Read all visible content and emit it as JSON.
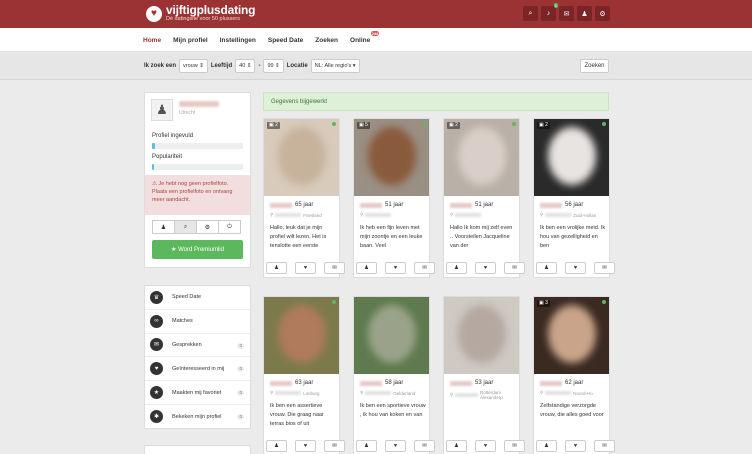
{
  "brand": {
    "name": "vijftigplusdating",
    "tagline": "Dé datingsite voor 50 plussers",
    "logo_icon": "heart-icon"
  },
  "top_icons": [
    {
      "name": "search-icon",
      "glyph": "⌕",
      "badge": ""
    },
    {
      "name": "bell-icon",
      "glyph": "♪",
      "badge": "1"
    },
    {
      "name": "envelope-icon",
      "glyph": "✉",
      "badge": ""
    },
    {
      "name": "user-icon",
      "glyph": "♟",
      "badge": ""
    },
    {
      "name": "gear-icon",
      "glyph": "⚙",
      "badge": ""
    }
  ],
  "nav": {
    "items": [
      "Home",
      "Mijn profiel",
      "Instellingen",
      "Speed Date",
      "Zoeken",
      "Online"
    ],
    "online_badge": "244"
  },
  "search": {
    "label_looking": "Ik zoek een",
    "gender": "vrouw",
    "label_age": "Leeftijd",
    "age_min": "40",
    "age_sep": "-",
    "age_max": "99",
    "label_location": "Locatie",
    "location": "NL: Alle regio's",
    "button": "Zoeken"
  },
  "profile": {
    "city": "Utrecht",
    "filled_label": "Profiel ingevuld",
    "filled_value": 0.03,
    "popularity_label": "Populariteit",
    "popularity_value": 0.02,
    "alert": "Je hebt nog geen profielfoto. Plaats een profielfoto en ontvang meer aandacht.",
    "premium_button": "Word Premiumlid"
  },
  "menu": [
    {
      "label": "Speed Date",
      "icon": "trophy-icon",
      "glyph": "♛",
      "count": ""
    },
    {
      "label": "Matches",
      "icon": "rings-icon",
      "glyph": "∞",
      "count": ""
    },
    {
      "label": "Gesprekken",
      "icon": "envelope-icon",
      "glyph": "✉",
      "count": "0"
    },
    {
      "label": "Geïnteresseerd in mij",
      "icon": "heart-icon",
      "glyph": "♥",
      "count": "0"
    },
    {
      "label": "Maakten mij favoriet",
      "icon": "star-icon",
      "glyph": "★",
      "count": "0"
    },
    {
      "label": "Bekeken mijn profiel",
      "icon": "users-icon",
      "glyph": "✱",
      "count": "0"
    }
  ],
  "success_message": "Gegevens bijgewerkt",
  "cards": [
    {
      "age": "65 jaar",
      "location": "Friesland",
      "photos": "2",
      "online": true,
      "desc": "Hallo, leuk dat je mijn profiel wilt lezen. Het is tenslotte een eerste",
      "color": "#d8cbbb",
      "blob": "#c7b29c"
    },
    {
      "age": "51 jaar",
      "location": "",
      "photos": "5",
      "online": true,
      "desc": "Ik heb een fijn leven met mijn zoontje en een leuke baan. Veel",
      "color": "#9a8f83",
      "blob": "#8a5a3c"
    },
    {
      "age": "51 jaar",
      "location": "",
      "photos": "2",
      "online": true,
      "desc": "Hallo Ik kom mij zelf even .. Voorstellen Jacqueline van der",
      "color": "#b9b1a8",
      "blob": "#d9cfc8"
    },
    {
      "age": "56 jaar",
      "location": "Zuid-Hollan",
      "photos": "2",
      "online": true,
      "desc": "Ik ben een vrolijke meid. Ik hou van gezelligheid en ben",
      "color": "#2a2a2a",
      "blob": "#e8e4e2"
    },
    {
      "age": "63 jaar",
      "location": "Limburg",
      "photos": "",
      "online": true,
      "desc": "Ik ben een assertieve vrouw. Die graag naar terras bios of uit",
      "color": "#7c7a4c",
      "blob": "#b07a5c"
    },
    {
      "age": "58 jaar",
      "location": "Gelderland",
      "photos": "",
      "online": false,
      "desc": "Ik ben een sportieve vrouw , ik hou van koken en van",
      "color": "#5f7a4e",
      "blob": "#9aa38a"
    },
    {
      "age": "53 jaar",
      "location": "Rotterdam Alexanderp",
      "photos": "",
      "online": false,
      "desc": "",
      "color": "#cfc9c3",
      "blob": "#b5a8a0"
    },
    {
      "age": "62 jaar",
      "location": "Noord-Ho",
      "photos": "3",
      "online": true,
      "desc": "Zelfstandige verzorgde vrouw, die alles goed voor",
      "color": "#3b2a22",
      "blob": "#c9a48a"
    }
  ],
  "card_actions": [
    {
      "name": "profile-action-icon",
      "glyph": "♟"
    },
    {
      "name": "like-action-icon",
      "glyph": "♥"
    },
    {
      "name": "message-action-icon",
      "glyph": "✉"
    }
  ]
}
